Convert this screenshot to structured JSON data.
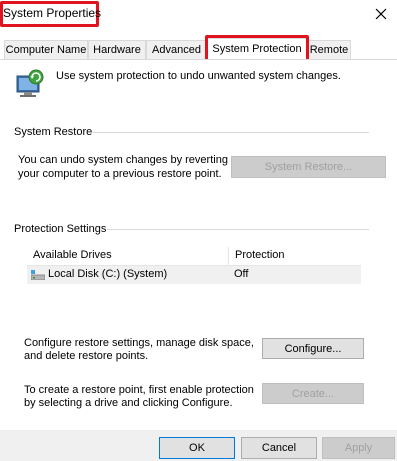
{
  "window": {
    "title": "System Properties",
    "close_icon": "close-icon"
  },
  "tabs": [
    {
      "label": "Computer Name",
      "active": false
    },
    {
      "label": "Hardware",
      "active": false
    },
    {
      "label": "Advanced",
      "active": false
    },
    {
      "label": "System Protection",
      "active": true
    },
    {
      "label": "Remote",
      "active": false
    }
  ],
  "intro": {
    "icon": "system-protection-icon",
    "text": "Use system protection to undo unwanted system changes."
  },
  "system_restore": {
    "heading": "System Restore",
    "description_line1": "You can undo system changes by reverting",
    "description_line2": "your computer to a previous restore point.",
    "button": "System Restore..."
  },
  "protection_settings": {
    "heading": "Protection Settings",
    "columns": [
      "Available Drives",
      "Protection"
    ],
    "drives": [
      {
        "name": "Local Disk (C:) (System)",
        "protection": "Off",
        "icon": "drive-icon"
      }
    ]
  },
  "configure": {
    "line1": "Configure restore settings, manage disk space,",
    "line2": "and delete restore points.",
    "button": "Configure..."
  },
  "create": {
    "line1": "To create a restore point, first enable protection",
    "line2": "by selecting a drive and clicking Configure.",
    "button": "Create..."
  },
  "footer": {
    "ok": "OK",
    "cancel": "Cancel",
    "apply": "Apply"
  },
  "colors": {
    "highlight": "#e0141e",
    "accent": "#0078d7"
  }
}
